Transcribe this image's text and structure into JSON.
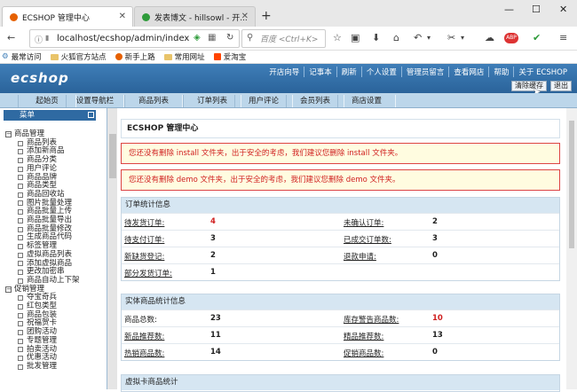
{
  "browser": {
    "tabs": [
      {
        "title": "ECSHOP 管理中心"
      },
      {
        "title": "发表博文 - hillsowl - 开..."
      }
    ],
    "url": "localhost/ecshop/admin/index",
    "search_placeholder": "百度 <Ctrl+K>",
    "bookmarks": [
      "最常访问",
      "火狐官方站点",
      "新手上路",
      "常用网址",
      "爱淘宝"
    ]
  },
  "app": {
    "logo": "ecshop",
    "top_links": [
      "开店向导",
      "记事本",
      "刷新",
      "个人设置",
      "管理员留言",
      "查看网店",
      "帮助",
      "关于 ECSHOP"
    ],
    "clear_cache": "清除缓存",
    "logout": "退出",
    "menu": [
      "起始页",
      "设置导航栏",
      "商品列表",
      "订单列表",
      "用户评论",
      "会员列表",
      "商店设置"
    ]
  },
  "sidebar": {
    "title": "菜单",
    "groups": [
      {
        "label": "商品管理",
        "items": [
          "商品列表",
          "添加新商品",
          "商品分类",
          "用户评论",
          "商品品牌",
          "商品类型",
          "商品回收站",
          "图片批量处理",
          "商品批量上传",
          "商品批量导出",
          "商品批量修改",
          "生成商品代码",
          "标签管理",
          "虚拟商品列表",
          "添加虚拟商品",
          "更改加密串",
          "商品自动上下架"
        ]
      },
      {
        "label": "促销管理",
        "items": [
          "夺宝奇兵",
          "红包类型",
          "商品包装",
          "祝福贺卡",
          "团购活动",
          "专题管理",
          "拍卖活动",
          "优惠活动",
          "批发管理"
        ]
      }
    ]
  },
  "main": {
    "title": "ECSHOP 管理中心",
    "warnings": [
      "您还没有删除 install 文件夹，出于安全的考虑，我们建议您删除 install 文件夹。",
      "您还没有删除 demo 文件夹，出于安全的考虑，我们建议您删除 demo 文件夹。"
    ],
    "order_stats": {
      "title": "订单统计信息",
      "rows": [
        {
          "l1": "待发货订单:",
          "v1": "4",
          "l2": "未确认订单:",
          "v2": "2"
        },
        {
          "l1": "待支付订单:",
          "v1": "3",
          "l2": "已成交订单数:",
          "v2": "3"
        },
        {
          "l1": "新缺货登记:",
          "v1": "2",
          "l2": "退款申请:",
          "v2": "0"
        },
        {
          "l1": "部分发货订单:",
          "v1": "1",
          "l2": "",
          "v2": ""
        }
      ]
    },
    "goods_stats": {
      "title": "实体商品统计信息",
      "rows": [
        {
          "l1": "商品总数:",
          "v1": "23",
          "l2": "库存警告商品数:",
          "v2": "10"
        },
        {
          "l1": "新品推荐数:",
          "v1": "11",
          "l2": "精品推荐数:",
          "v2": "13"
        },
        {
          "l1": "热销商品数:",
          "v1": "14",
          "l2": "促销商品数:",
          "v2": "0"
        }
      ]
    },
    "virtual_stats": {
      "title": "虚拟卡商品统计"
    }
  }
}
